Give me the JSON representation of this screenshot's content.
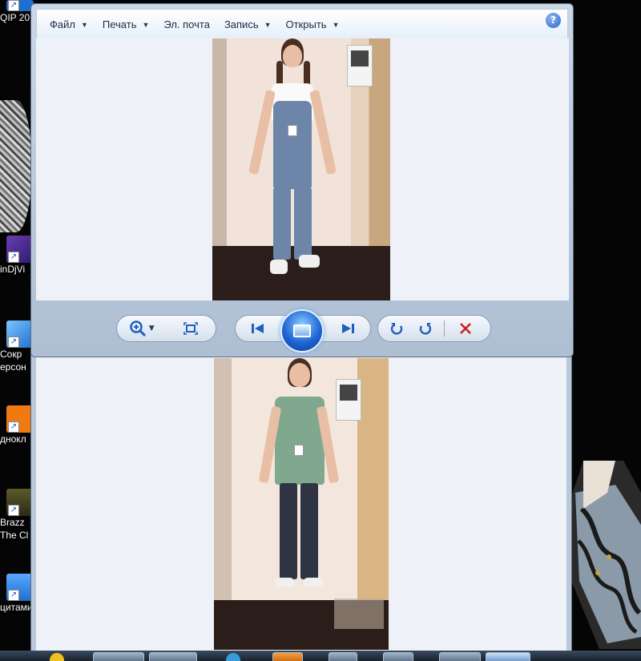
{
  "desktop": {
    "icons": [
      {
        "label": "QIP 20",
        "color": "#1d6fd1",
        "icon": "qip-icon"
      },
      {
        "label": "inDjVi",
        "color": "#6a3fb0",
        "icon": "windjview-icon"
      },
      {
        "label": "Сокр",
        "label2": "ерсон",
        "color": "#2a7fd6",
        "icon": "recovery-icon"
      },
      {
        "label": "днокл",
        "color": "#f07a10",
        "icon": "odnoklassniki-icon"
      },
      {
        "label": "Brazz",
        "label2": "The Cl",
        "color": "#3e3a20",
        "icon": "album-icon"
      },
      {
        "label": "цитами",
        "color": "#1f7ad6",
        "icon": "doc-icon"
      }
    ]
  },
  "viewer_top": {
    "menu": [
      {
        "label": "Файл",
        "has_caret": true
      },
      {
        "label": "Печать",
        "has_caret": true
      },
      {
        "label": "Эл. почта",
        "has_caret": false
      },
      {
        "label": "Запись",
        "has_caret": true
      },
      {
        "label": "Открыть",
        "has_caret": true
      }
    ],
    "help_label": "?",
    "caret": "▼"
  },
  "controls": {
    "zoom_icon": "zoom-icon",
    "fit_icon": "actual-size-icon",
    "prev_icon": "previous-icon",
    "slideshow_icon": "slideshow-icon",
    "next_icon": "next-icon",
    "rotate_left_icon": "rotate-left-icon",
    "rotate_right_icon": "rotate-right-icon",
    "delete_icon": "delete-icon",
    "delete_color": "#cc1f1f"
  },
  "colors": {
    "accent": "#1f5fc1",
    "window_frame": "#b9c9dc",
    "viewer_bg": "#eef2f8"
  }
}
